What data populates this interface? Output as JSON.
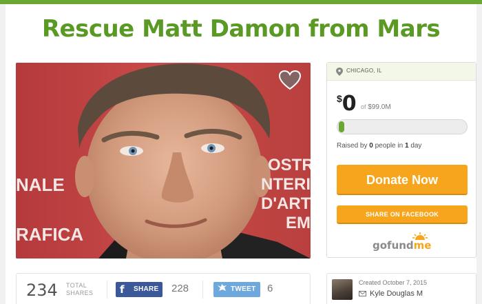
{
  "campaign": {
    "title": "Rescue Matt Damon from Mars"
  },
  "photo": {
    "banner_left_lines": [
      "NALE",
      "RAFICA"
    ],
    "banner_right_lines": [
      "OSTR",
      "NTERI",
      "D'ARTE",
      "EM"
    ],
    "favorite_icon": "heart-icon"
  },
  "sidebar": {
    "location": "CHICAGO, IL",
    "location_icon": "map-pin-icon",
    "currency": "$",
    "amount": "0",
    "goal_prefix": "of",
    "goal": "$99.0M",
    "progress_fraction": 0.0,
    "raised_by_prefix": "Raised by",
    "people_count": "0",
    "people_label": "people in",
    "days_count": "1",
    "days_label": "day",
    "donate_label": "Donate Now",
    "share_facebook_label": "SHARE ON FACEBOOK",
    "logo_text_a": "gofund",
    "logo_text_b": "me",
    "brand_color": "#6aa632",
    "accent_color": "#f7a51d"
  },
  "stats": {
    "total_shares": "234",
    "total_label_1": "TOTAL",
    "total_label_2": "SHARES",
    "facebook_icon": "f",
    "facebook_label": "SHARE",
    "facebook_count": "228",
    "twitter_icon": "twitter-bird-icon",
    "twitter_label": "TWEET",
    "twitter_count": "6"
  },
  "creator": {
    "created": "Created October 7, 2015",
    "organizer": "Kyle Douglas M",
    "mail_icon": "envelope-icon"
  }
}
